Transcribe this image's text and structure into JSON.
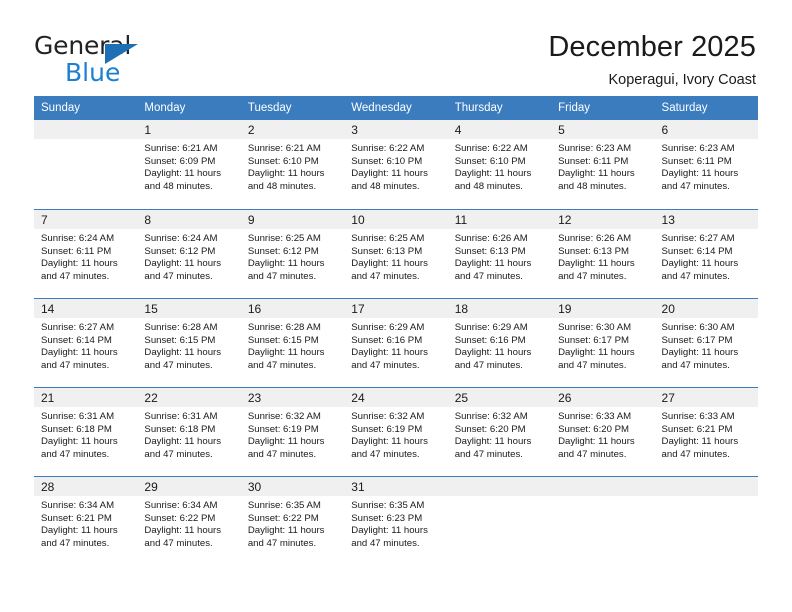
{
  "brand": {
    "name_line1": "General",
    "name_line2": "Blue",
    "triangle_color": "#1f6fb5",
    "blue_text_color": "#1b7fd4"
  },
  "header": {
    "title": "December 2025",
    "subtitle": "Koperagui, Ivory Coast"
  },
  "colors": {
    "header_blue": "#3a7cbe",
    "daynum_band": "#f0f0f0",
    "text": "#1a1a1a"
  },
  "weekdays": [
    "Sunday",
    "Monday",
    "Tuesday",
    "Wednesday",
    "Thursday",
    "Friday",
    "Saturday"
  ],
  "labels": {
    "sunrise_prefix": "Sunrise:",
    "sunset_prefix": "Sunset:",
    "daylight_prefix": "Daylight:"
  },
  "weeks": [
    [
      {
        "day": "",
        "empty": true,
        "sunrise": "",
        "sunset": "",
        "daylight_l1": "",
        "daylight_l2": ""
      },
      {
        "day": "1",
        "sunrise": "Sunrise: 6:21 AM",
        "sunset": "Sunset: 6:09 PM",
        "daylight_l1": "Daylight: 11 hours",
        "daylight_l2": "and 48 minutes."
      },
      {
        "day": "2",
        "sunrise": "Sunrise: 6:21 AM",
        "sunset": "Sunset: 6:10 PM",
        "daylight_l1": "Daylight: 11 hours",
        "daylight_l2": "and 48 minutes."
      },
      {
        "day": "3",
        "sunrise": "Sunrise: 6:22 AM",
        "sunset": "Sunset: 6:10 PM",
        "daylight_l1": "Daylight: 11 hours",
        "daylight_l2": "and 48 minutes."
      },
      {
        "day": "4",
        "sunrise": "Sunrise: 6:22 AM",
        "sunset": "Sunset: 6:10 PM",
        "daylight_l1": "Daylight: 11 hours",
        "daylight_l2": "and 48 minutes."
      },
      {
        "day": "5",
        "sunrise": "Sunrise: 6:23 AM",
        "sunset": "Sunset: 6:11 PM",
        "daylight_l1": "Daylight: 11 hours",
        "daylight_l2": "and 48 minutes."
      },
      {
        "day": "6",
        "sunrise": "Sunrise: 6:23 AM",
        "sunset": "Sunset: 6:11 PM",
        "daylight_l1": "Daylight: 11 hours",
        "daylight_l2": "and 47 minutes."
      }
    ],
    [
      {
        "day": "7",
        "sunrise": "Sunrise: 6:24 AM",
        "sunset": "Sunset: 6:11 PM",
        "daylight_l1": "Daylight: 11 hours",
        "daylight_l2": "and 47 minutes."
      },
      {
        "day": "8",
        "sunrise": "Sunrise: 6:24 AM",
        "sunset": "Sunset: 6:12 PM",
        "daylight_l1": "Daylight: 11 hours",
        "daylight_l2": "and 47 minutes."
      },
      {
        "day": "9",
        "sunrise": "Sunrise: 6:25 AM",
        "sunset": "Sunset: 6:12 PM",
        "daylight_l1": "Daylight: 11 hours",
        "daylight_l2": "and 47 minutes."
      },
      {
        "day": "10",
        "sunrise": "Sunrise: 6:25 AM",
        "sunset": "Sunset: 6:13 PM",
        "daylight_l1": "Daylight: 11 hours",
        "daylight_l2": "and 47 minutes."
      },
      {
        "day": "11",
        "sunrise": "Sunrise: 6:26 AM",
        "sunset": "Sunset: 6:13 PM",
        "daylight_l1": "Daylight: 11 hours",
        "daylight_l2": "and 47 minutes."
      },
      {
        "day": "12",
        "sunrise": "Sunrise: 6:26 AM",
        "sunset": "Sunset: 6:13 PM",
        "daylight_l1": "Daylight: 11 hours",
        "daylight_l2": "and 47 minutes."
      },
      {
        "day": "13",
        "sunrise": "Sunrise: 6:27 AM",
        "sunset": "Sunset: 6:14 PM",
        "daylight_l1": "Daylight: 11 hours",
        "daylight_l2": "and 47 minutes."
      }
    ],
    [
      {
        "day": "14",
        "sunrise": "Sunrise: 6:27 AM",
        "sunset": "Sunset: 6:14 PM",
        "daylight_l1": "Daylight: 11 hours",
        "daylight_l2": "and 47 minutes."
      },
      {
        "day": "15",
        "sunrise": "Sunrise: 6:28 AM",
        "sunset": "Sunset: 6:15 PM",
        "daylight_l1": "Daylight: 11 hours",
        "daylight_l2": "and 47 minutes."
      },
      {
        "day": "16",
        "sunrise": "Sunrise: 6:28 AM",
        "sunset": "Sunset: 6:15 PM",
        "daylight_l1": "Daylight: 11 hours",
        "daylight_l2": "and 47 minutes."
      },
      {
        "day": "17",
        "sunrise": "Sunrise: 6:29 AM",
        "sunset": "Sunset: 6:16 PM",
        "daylight_l1": "Daylight: 11 hours",
        "daylight_l2": "and 47 minutes."
      },
      {
        "day": "18",
        "sunrise": "Sunrise: 6:29 AM",
        "sunset": "Sunset: 6:16 PM",
        "daylight_l1": "Daylight: 11 hours",
        "daylight_l2": "and 47 minutes."
      },
      {
        "day": "19",
        "sunrise": "Sunrise: 6:30 AM",
        "sunset": "Sunset: 6:17 PM",
        "daylight_l1": "Daylight: 11 hours",
        "daylight_l2": "and 47 minutes."
      },
      {
        "day": "20",
        "sunrise": "Sunrise: 6:30 AM",
        "sunset": "Sunset: 6:17 PM",
        "daylight_l1": "Daylight: 11 hours",
        "daylight_l2": "and 47 minutes."
      }
    ],
    [
      {
        "day": "21",
        "sunrise": "Sunrise: 6:31 AM",
        "sunset": "Sunset: 6:18 PM",
        "daylight_l1": "Daylight: 11 hours",
        "daylight_l2": "and 47 minutes."
      },
      {
        "day": "22",
        "sunrise": "Sunrise: 6:31 AM",
        "sunset": "Sunset: 6:18 PM",
        "daylight_l1": "Daylight: 11 hours",
        "daylight_l2": "and 47 minutes."
      },
      {
        "day": "23",
        "sunrise": "Sunrise: 6:32 AM",
        "sunset": "Sunset: 6:19 PM",
        "daylight_l1": "Daylight: 11 hours",
        "daylight_l2": "and 47 minutes."
      },
      {
        "day": "24",
        "sunrise": "Sunrise: 6:32 AM",
        "sunset": "Sunset: 6:19 PM",
        "daylight_l1": "Daylight: 11 hours",
        "daylight_l2": "and 47 minutes."
      },
      {
        "day": "25",
        "sunrise": "Sunrise: 6:32 AM",
        "sunset": "Sunset: 6:20 PM",
        "daylight_l1": "Daylight: 11 hours",
        "daylight_l2": "and 47 minutes."
      },
      {
        "day": "26",
        "sunrise": "Sunrise: 6:33 AM",
        "sunset": "Sunset: 6:20 PM",
        "daylight_l1": "Daylight: 11 hours",
        "daylight_l2": "and 47 minutes."
      },
      {
        "day": "27",
        "sunrise": "Sunrise: 6:33 AM",
        "sunset": "Sunset: 6:21 PM",
        "daylight_l1": "Daylight: 11 hours",
        "daylight_l2": "and 47 minutes."
      }
    ],
    [
      {
        "day": "28",
        "sunrise": "Sunrise: 6:34 AM",
        "sunset": "Sunset: 6:21 PM",
        "daylight_l1": "Daylight: 11 hours",
        "daylight_l2": "and 47 minutes."
      },
      {
        "day": "29",
        "sunrise": "Sunrise: 6:34 AM",
        "sunset": "Sunset: 6:22 PM",
        "daylight_l1": "Daylight: 11 hours",
        "daylight_l2": "and 47 minutes."
      },
      {
        "day": "30",
        "sunrise": "Sunrise: 6:35 AM",
        "sunset": "Sunset: 6:22 PM",
        "daylight_l1": "Daylight: 11 hours",
        "daylight_l2": "and 47 minutes."
      },
      {
        "day": "31",
        "sunrise": "Sunrise: 6:35 AM",
        "sunset": "Sunset: 6:23 PM",
        "daylight_l1": "Daylight: 11 hours",
        "daylight_l2": "and 47 minutes."
      },
      {
        "day": "",
        "empty": true,
        "sunrise": "",
        "sunset": "",
        "daylight_l1": "",
        "daylight_l2": ""
      },
      {
        "day": "",
        "empty": true,
        "sunrise": "",
        "sunset": "",
        "daylight_l1": "",
        "daylight_l2": ""
      },
      {
        "day": "",
        "empty": true,
        "sunrise": "",
        "sunset": "",
        "daylight_l1": "",
        "daylight_l2": ""
      }
    ]
  ]
}
